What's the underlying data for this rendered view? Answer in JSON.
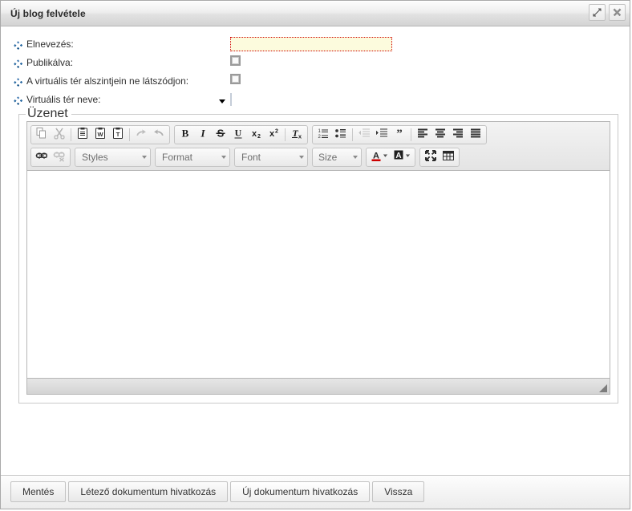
{
  "window": {
    "title": "Új blog felvétele",
    "maximize_icon": "maximize-icon",
    "close_icon": "close-icon"
  },
  "form": {
    "fields": [
      {
        "label": "Elnevezés:",
        "type": "text",
        "value": "",
        "required": true
      },
      {
        "label": "Publikálva:",
        "type": "checkbox",
        "checked": false
      },
      {
        "label": "A virtuális tér alszintjein ne látszódjon:",
        "type": "checkbox",
        "checked": false
      },
      {
        "label": "Virtuális tér neve:",
        "type": "select",
        "value": "",
        "options": [
          ""
        ]
      }
    ]
  },
  "fieldset": {
    "legend": "Üzenet"
  },
  "editor": {
    "content": "",
    "toolbar_row1": [
      {
        "name": "copy-icon",
        "label": "Copy",
        "disabled": false
      },
      {
        "name": "cut-icon",
        "label": "Cut",
        "disabled": true
      },
      {
        "name": "separator",
        "label": ""
      },
      {
        "name": "paste-icon",
        "label": "Paste",
        "disabled": false
      },
      {
        "name": "paste-from-word-icon",
        "label": "Paste from Word",
        "disabled": false
      },
      {
        "name": "paste-as-text-icon",
        "label": "Paste as plain text",
        "disabled": false
      },
      {
        "name": "separator",
        "label": ""
      },
      {
        "name": "redo-icon",
        "label": "Redo",
        "disabled": true
      },
      {
        "name": "undo-icon",
        "label": "Undo",
        "disabled": true
      }
    ],
    "toolbar_row1_group2": [
      {
        "name": "bold-icon",
        "label": "B"
      },
      {
        "name": "italic-icon",
        "label": "I"
      },
      {
        "name": "strikethrough-icon",
        "label": "S"
      },
      {
        "name": "underline-icon",
        "label": "U"
      },
      {
        "name": "subscript-icon",
        "label": "x2"
      },
      {
        "name": "superscript-icon",
        "label": "x2"
      },
      {
        "name": "separator",
        "label": ""
      },
      {
        "name": "remove-format-icon",
        "label": "Tx"
      }
    ],
    "toolbar_row1_group3": [
      {
        "name": "numbered-list-icon",
        "label": "Numbered list",
        "disabled": false
      },
      {
        "name": "bulleted-list-icon",
        "label": "Bulleted list",
        "disabled": false
      },
      {
        "name": "separator",
        "label": ""
      },
      {
        "name": "outdent-icon",
        "label": "Decrease indent",
        "disabled": true
      },
      {
        "name": "indent-icon",
        "label": "Increase indent",
        "disabled": false
      },
      {
        "name": "blockquote-icon",
        "label": "Block quote",
        "disabled": false
      },
      {
        "name": "separator",
        "label": ""
      },
      {
        "name": "align-left-icon",
        "label": "Align left",
        "disabled": false
      },
      {
        "name": "align-center-icon",
        "label": "Center",
        "disabled": false
      },
      {
        "name": "align-right-icon",
        "label": "Align right",
        "disabled": false
      },
      {
        "name": "align-justify-icon",
        "label": "Justify",
        "disabled": false
      }
    ],
    "toolbar_row2_group1": [
      {
        "name": "link-icon",
        "label": "Link",
        "disabled": false
      },
      {
        "name": "unlink-icon",
        "label": "Unlink",
        "disabled": true
      }
    ],
    "combos": [
      {
        "name": "styles-combo",
        "label": "Styles"
      },
      {
        "name": "format-combo",
        "label": "Format"
      },
      {
        "name": "font-combo",
        "label": "Font"
      },
      {
        "name": "size-combo",
        "label": "Size"
      }
    ],
    "toolbar_row2_group3": [
      {
        "name": "text-color-icon",
        "label": "Text Color"
      },
      {
        "name": "background-color-icon",
        "label": "Background Color"
      }
    ],
    "toolbar_row2_group4": [
      {
        "name": "maximize-icon",
        "label": "Maximize"
      },
      {
        "name": "table-icon",
        "label": "Table"
      }
    ],
    "resize_grip": "resize-grip"
  },
  "footer": {
    "buttons": [
      {
        "label": "Mentés",
        "name": "save-button"
      },
      {
        "label": "Létező dokumentum hivatkozás",
        "name": "existing-document-link-button"
      },
      {
        "label": "Új dokumentum hivatkozás",
        "name": "new-document-link-button"
      },
      {
        "label": "Vissza",
        "name": "back-button"
      }
    ]
  },
  "colors": {
    "required_field_bg": "#fcfbdd",
    "required_field_border": "#d00000",
    "bullet_icon": "#2e6da4",
    "text_color_accent": "#cc0000"
  }
}
